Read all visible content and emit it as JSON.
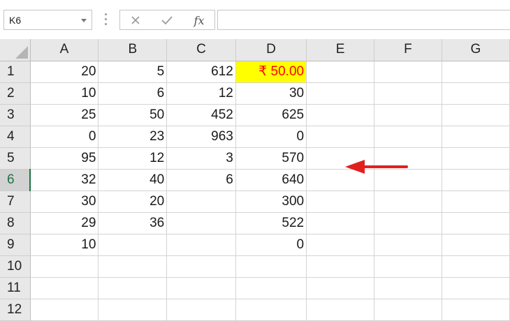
{
  "name_box": {
    "value": "K6"
  },
  "formula_bar": {
    "cancel_glyph": "✕",
    "enter_glyph": "✓",
    "function_label": "fx",
    "content": ""
  },
  "columns": [
    "A",
    "B",
    "C",
    "D",
    "E",
    "F",
    "G"
  ],
  "rows": [
    {
      "label": "1",
      "cells": [
        "20",
        "5",
        "612",
        "₹ 50.00",
        "",
        "",
        ""
      ]
    },
    {
      "label": "2",
      "cells": [
        "10",
        "6",
        "12",
        "30",
        "",
        "",
        ""
      ]
    },
    {
      "label": "3",
      "cells": [
        "25",
        "50",
        "452",
        "625",
        "",
        "",
        ""
      ]
    },
    {
      "label": "4",
      "cells": [
        "0",
        "23",
        "963",
        "0",
        "",
        "",
        ""
      ]
    },
    {
      "label": "5",
      "cells": [
        "95",
        "12",
        "3",
        "570",
        "",
        "",
        ""
      ]
    },
    {
      "label": "6",
      "cells": [
        "32",
        "40",
        "6",
        "640",
        "",
        "",
        ""
      ]
    },
    {
      "label": "7",
      "cells": [
        "30",
        "20",
        "",
        "300",
        "",
        "",
        ""
      ]
    },
    {
      "label": "8",
      "cells": [
        "29",
        "36",
        "",
        "522",
        "",
        "",
        ""
      ]
    },
    {
      "label": "9",
      "cells": [
        "10",
        "",
        "",
        "0",
        "",
        "",
        ""
      ]
    },
    {
      "label": "10",
      "cells": [
        "",
        "",
        "",
        "",
        "",
        "",
        ""
      ]
    },
    {
      "label": "11",
      "cells": [
        "",
        "",
        "",
        "",
        "",
        "",
        ""
      ]
    },
    {
      "label": "12",
      "cells": [
        "",
        "",
        "",
        "",
        "",
        "",
        ""
      ]
    }
  ],
  "active_row": "6",
  "highlighted_cell": {
    "row": "1",
    "column": "D",
    "fill": "#ffff00",
    "text_color": "#ff0000"
  },
  "colors": {
    "accent": "#217346",
    "arrow": "#e02020"
  },
  "icons": [
    "cancel-icon",
    "enter-icon",
    "function-icon",
    "dropdown-caret-icon",
    "select-all-triangle-icon",
    "arrow-left-icon"
  ]
}
